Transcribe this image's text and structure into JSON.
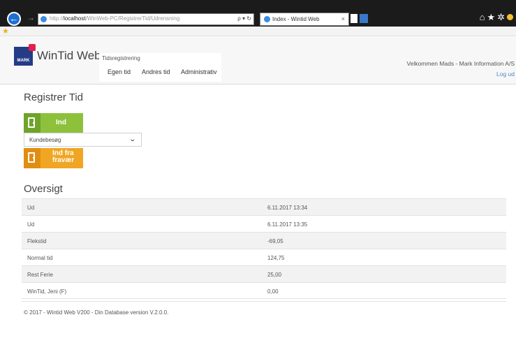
{
  "browser": {
    "address_host": "localhost",
    "address_path": "/WinWeb-PC/RegistrerTid/Udrensning",
    "address_prefix": "http://",
    "tab_title": "Index - Wintid Web",
    "tab_close": "×",
    "address_tools": "ρ ▾ ↻"
  },
  "header": {
    "logo_text": "MARK",
    "app_title": "WinTid Web",
    "nav_section": "Tidsregistrering",
    "nav_links": [
      "Egen tid",
      "Andres tid",
      "Administrativ"
    ],
    "welcome": "Velkommen Mads - Mark Information A/S",
    "logout": "Log ud"
  },
  "register": {
    "title": "Registrer Tid",
    "in_button": "Ind",
    "select_value": "Kundebesøg",
    "absence_button_line1": "Ind fra",
    "absence_button_line2": "fravær"
  },
  "overview": {
    "title": "Oversigt",
    "rows": [
      {
        "label": "Ud",
        "value": "6.11.2017 13:34"
      },
      {
        "label": "Ud",
        "value": "6.11.2017 13:35"
      },
      {
        "label": "Flekstid",
        "value": "-69,05"
      },
      {
        "label": "Normal tid",
        "value": "124,75"
      },
      {
        "label": "Rest Ferie",
        "value": "25,00"
      },
      {
        "label": "WinTid, Jeni (F)",
        "value": "0,00"
      }
    ]
  },
  "footer": "© 2017 - Wintid Web V200 - Din Database version V.2.0.0.",
  "colors": {
    "in_green": "#8dc13c",
    "absence_orange": "#f0a623",
    "logo_blue": "#243b86",
    "logo_red": "#e21f4a",
    "link_blue": "#4b86c7"
  },
  "icons": [
    "back-arrow-icon",
    "forward-arrow-icon",
    "home-icon",
    "favorites-star-icon",
    "settings-gear-icon",
    "smiley-icon",
    "door-in-icon",
    "chevron-down-icon"
  ]
}
